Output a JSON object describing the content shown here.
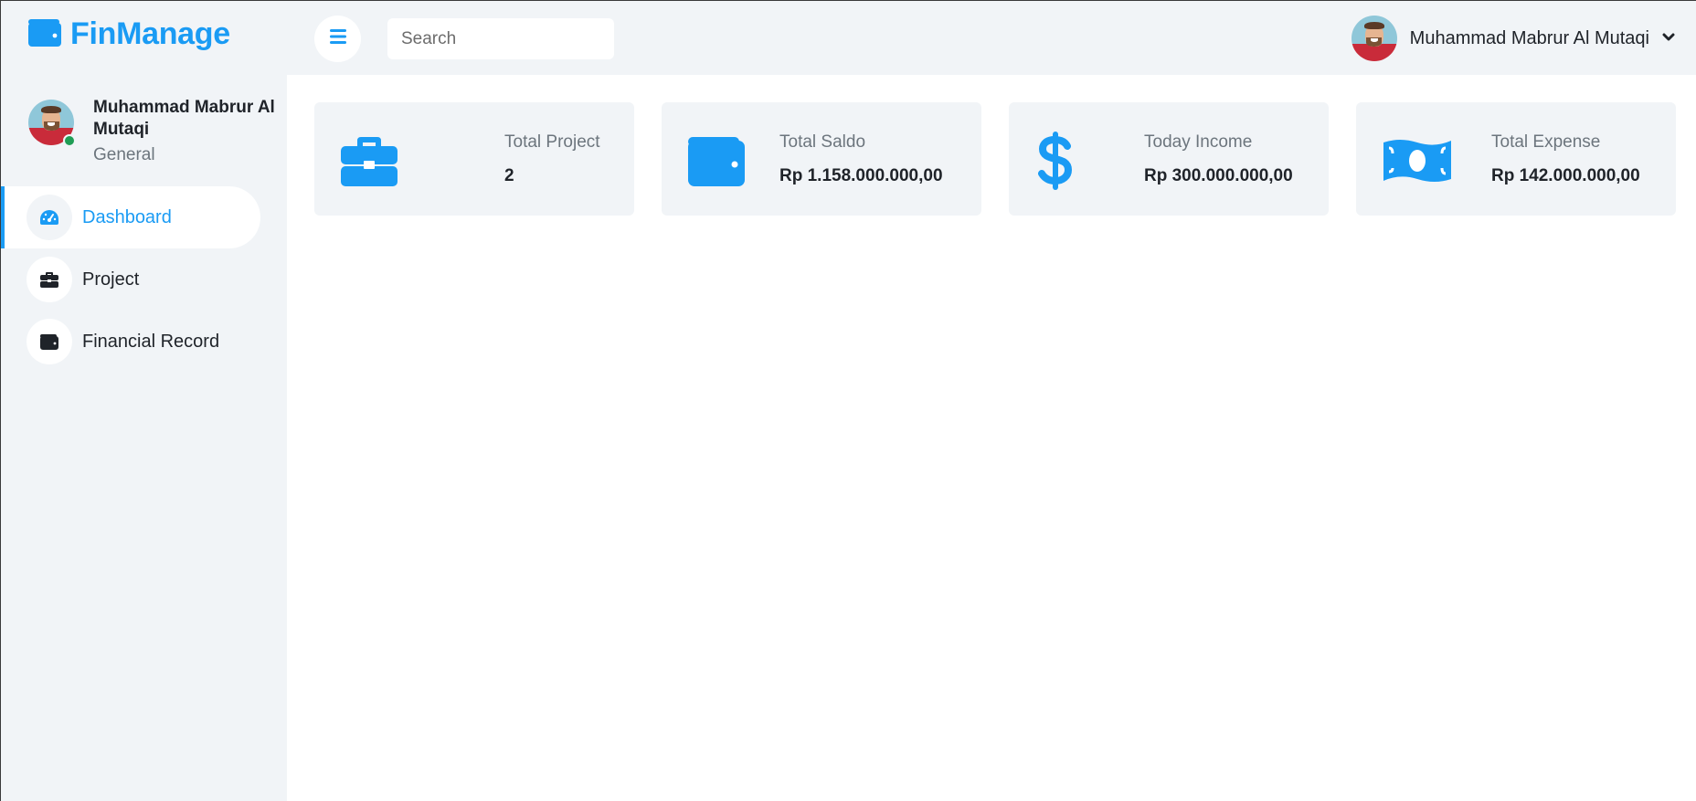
{
  "brand": {
    "name": "FinManage",
    "icon": "wallet-icon",
    "color": "#1a9bf4"
  },
  "header": {
    "menu_icon": "hamburger-icon",
    "search": {
      "placeholder": "Search",
      "value": ""
    },
    "user": {
      "name": "Muhammad Mabrur Al Mutaqi",
      "dropdown_icon": "chevron-down-icon"
    }
  },
  "sidebar": {
    "profile": {
      "name": "Muhammad Mabrur Al Mutaqi",
      "role": "General",
      "status": "online",
      "status_color": "#1f9d55"
    },
    "items": [
      {
        "label": "Dashboard",
        "icon": "speedometer-icon",
        "active": true
      },
      {
        "label": "Project",
        "icon": "briefcase-icon",
        "active": false
      },
      {
        "label": "Financial Record",
        "icon": "wallet-icon",
        "active": false
      }
    ]
  },
  "stats": [
    {
      "title": "Total Project",
      "value": "2",
      "icon": "briefcase-icon"
    },
    {
      "title": "Total Saldo",
      "value": "Rp 1.158.000.000,00",
      "icon": "wallet-icon"
    },
    {
      "title": "Today Income",
      "value": "Rp 300.000.000,00",
      "icon": "dollar-icon"
    },
    {
      "title": "Total Expense",
      "value": "Rp 142.000.000,00",
      "icon": "money-bill-icon"
    }
  ],
  "colors": {
    "accent": "#1a9bf4",
    "background": "#f1f4f7",
    "text": "#1f2329",
    "muted": "#6c757d"
  }
}
